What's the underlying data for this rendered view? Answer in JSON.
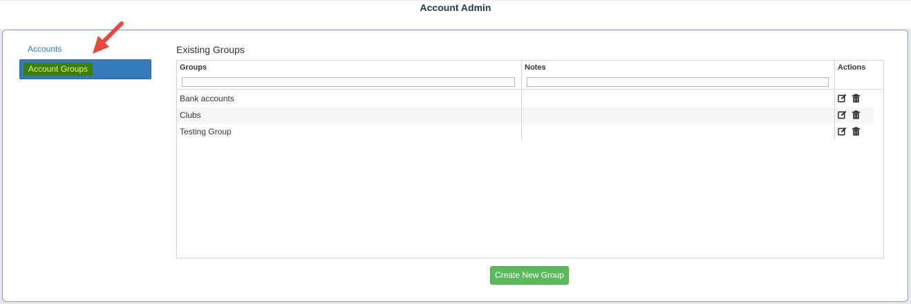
{
  "header": {
    "title": "Account Admin"
  },
  "sidebar": {
    "items": [
      {
        "label": "Accounts",
        "active": false
      },
      {
        "label": "Account Groups",
        "active": true
      }
    ]
  },
  "main": {
    "section_title": "Existing Groups",
    "table": {
      "columns": [
        "Groups",
        "Notes",
        "Actions"
      ],
      "filters": {
        "groups": "",
        "notes": ""
      },
      "rows": [
        {
          "group": "Bank accounts",
          "notes": ""
        },
        {
          "group": "Clubs",
          "notes": ""
        },
        {
          "group": "Testing Group",
          "notes": ""
        }
      ],
      "row_actions": [
        "edit-icon",
        "trash-icon"
      ]
    },
    "create_button_label": "Create New Group"
  },
  "colors": {
    "accent": "#337ab7",
    "highlight_bg": "#3b7d12",
    "highlight_text": "#f4f46e",
    "button_green": "#5cb85c",
    "arrow": "#e8473d"
  }
}
